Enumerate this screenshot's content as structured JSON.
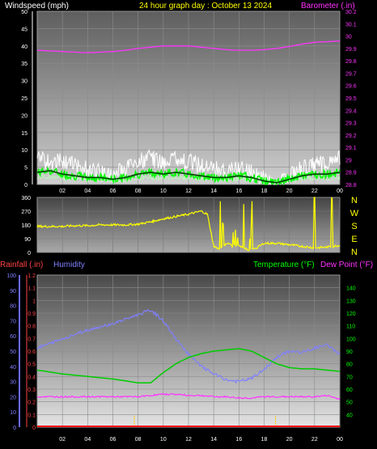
{
  "header": {
    "wind_label": "Windspeed (mph)",
    "title": "24 hour graph day : October 13 2024",
    "baro_label": "Barometer (.in)"
  },
  "labels": {
    "rain": "Rainfall (.in)",
    "humidity": "Humidity",
    "temperature": "Temperature (°F)",
    "dewpoint": "Dew Point (°F)"
  },
  "colors": {
    "background": "#000000",
    "header_text": "#ffffff",
    "title": "#ffff00",
    "barometer": "#ff33ff",
    "wind_gust": "#ffffff",
    "wind_avg": "#00ff00",
    "wind_direction": "#ffff00",
    "rain": "#ff0000",
    "humidity": "#8080ff",
    "temperature": "#00cc00",
    "dewpoint": "#ff33ff",
    "rain_axis": "#ff4444",
    "humidity_axis": "#6b6bff",
    "temp_axis": "#00ff00"
  },
  "chart_data": [
    {
      "id": "wind-baro",
      "type": "line",
      "x_ticks": [
        "02",
        "04",
        "06",
        "08",
        "10",
        "12",
        "14",
        "16",
        "18",
        "20",
        "22",
        "00"
      ],
      "x_range_hours": [
        0,
        24
      ],
      "y_left": {
        "label": "Windspeed (mph)",
        "range": [
          0,
          50
        ],
        "ticks": [
          0,
          5,
          10,
          15,
          20,
          25,
          30,
          35,
          40,
          45,
          50
        ]
      },
      "y_right": {
        "label": "Barometer (.in)",
        "range": [
          28.8,
          30.2
        ],
        "ticks": [
          "28.8",
          "28.9",
          "29",
          "29.1",
          "29.2",
          "29.3",
          "29.4",
          "29.5",
          "29.6",
          "29.7",
          "29.8",
          "29.9",
          "30",
          "30.1",
          "30.2"
        ]
      },
      "grid": true,
      "series": [
        {
          "name": "Barometer (.in)",
          "axis": "right",
          "x": [
            0,
            1,
            2,
            3,
            4,
            5,
            6,
            7,
            8,
            9,
            10,
            11,
            12,
            13,
            14,
            15,
            16,
            17,
            18,
            19,
            20,
            21,
            22,
            23,
            24
          ],
          "y": [
            29.885,
            29.88,
            29.875,
            29.87,
            29.865,
            29.87,
            29.875,
            29.885,
            29.9,
            29.91,
            29.92,
            29.92,
            29.92,
            29.91,
            29.9,
            29.89,
            29.885,
            29.885,
            29.89,
            29.9,
            29.915,
            29.935,
            29.95,
            29.955,
            29.96
          ]
        },
        {
          "name": "Windspeed gust",
          "axis": "left",
          "x": [
            0,
            1,
            2,
            3,
            4,
            5,
            6,
            7,
            8,
            9,
            10,
            11,
            12,
            13,
            14,
            15,
            16,
            17,
            18,
            19,
            20,
            21,
            22,
            23,
            24
          ],
          "y": [
            10,
            9,
            9,
            8,
            7,
            6,
            5,
            7,
            9,
            10,
            9,
            10,
            9,
            8,
            7,
            6,
            7,
            6,
            4,
            2,
            5,
            7,
            8,
            9,
            10
          ]
        },
        {
          "name": "Windspeed average",
          "axis": "left",
          "x": [
            0,
            1,
            2,
            3,
            4,
            5,
            6,
            7,
            8,
            9,
            10,
            11,
            12,
            13,
            14,
            15,
            16,
            17,
            18,
            19,
            20,
            21,
            22,
            23,
            24
          ],
          "y": [
            3.5,
            4,
            3,
            2.5,
            2,
            2,
            1.5,
            2,
            3,
            3.5,
            3,
            3.5,
            3,
            2.5,
            2,
            2,
            2.5,
            2,
            1,
            0.5,
            1.5,
            2.5,
            3,
            3,
            3.5
          ]
        }
      ]
    },
    {
      "id": "wind-direction",
      "type": "line",
      "x_range_hours": [
        0,
        24
      ],
      "y_left": {
        "range": [
          0,
          360
        ],
        "ticks": [
          0,
          90,
          180,
          270,
          360
        ]
      },
      "y_right": {
        "ticks": [
          "N",
          "W",
          "S",
          "E",
          "N"
        ]
      },
      "series": [
        {
          "name": "Wind direction",
          "x": [
            0,
            1,
            2,
            3,
            4,
            5,
            6,
            7,
            8,
            9,
            10,
            11,
            12,
            13,
            13.5,
            14,
            14.5,
            15,
            16,
            17,
            18,
            19,
            20,
            21,
            22,
            23,
            24
          ],
          "y": [
            170,
            170,
            170,
            175,
            175,
            180,
            180,
            180,
            185,
            200,
            220,
            235,
            250,
            270,
            250,
            40,
            20,
            60,
            40,
            10,
            60,
            60,
            50,
            40,
            30,
            35,
            45
          ]
        }
      ]
    },
    {
      "id": "temp-hum-rain",
      "type": "line",
      "x_ticks": [
        "02",
        "04",
        "06",
        "08",
        "10",
        "12",
        "14",
        "16",
        "18",
        "20",
        "22",
        "00"
      ],
      "x_range_hours": [
        0,
        24
      ],
      "y_left_rain": {
        "label": "Rainfall (.in)",
        "range": [
          0,
          1.2
        ],
        "ticks": [
          "0",
          "0.1",
          "0.2",
          "0.3",
          "0.4",
          "0.5",
          "0.6",
          "0.7",
          "0.8",
          "0.9",
          "1",
          "1.1",
          "1.2"
        ]
      },
      "y_left_humidity": {
        "label": "Humidity",
        "range": [
          0,
          100
        ],
        "ticks": [
          0,
          10,
          20,
          30,
          40,
          50,
          60,
          70,
          80,
          90,
          100
        ]
      },
      "y_right": {
        "label": "Temperature (°F)",
        "range": [
          30,
          150
        ],
        "ticks": [
          40,
          50,
          60,
          70,
          80,
          90,
          100,
          110,
          120,
          130,
          140
        ]
      },
      "grid": true,
      "series": [
        {
          "name": "Humidity",
          "axis": "humidity",
          "x": [
            0,
            2,
            4,
            6,
            8,
            9,
            10,
            11,
            12,
            13,
            14,
            15,
            16,
            17,
            18,
            19,
            20,
            21,
            22,
            23,
            24
          ],
          "y": [
            52,
            58,
            64,
            68,
            74,
            77,
            70,
            58,
            48,
            40,
            35,
            31,
            30,
            32,
            38,
            46,
            50,
            49,
            52,
            54,
            48
          ]
        },
        {
          "name": "Temperature (°F)",
          "axis": "right",
          "x": [
            0,
            2,
            4,
            6,
            8,
            9,
            10,
            11,
            12,
            13,
            14,
            15,
            16,
            17,
            18,
            19,
            20,
            21,
            22,
            23,
            24
          ],
          "y": [
            75,
            72,
            70,
            68,
            65,
            65,
            73,
            80,
            85,
            88,
            90,
            91,
            92,
            90,
            85,
            80,
            77,
            76,
            76,
            75,
            74
          ]
        },
        {
          "name": "Dew Point (°F)",
          "axis": "right",
          "x": [
            0,
            2,
            4,
            6,
            8,
            9,
            10,
            11,
            12,
            13,
            14,
            15,
            16,
            17,
            18,
            19,
            20,
            21,
            22,
            23,
            24
          ],
          "y": [
            54,
            54,
            54,
            54,
            54,
            55,
            56,
            56,
            55,
            55,
            54,
            54,
            53,
            53,
            54,
            54,
            54,
            54,
            54,
            55,
            52
          ]
        },
        {
          "name": "Rainfall (.in)",
          "axis": "rain",
          "x": [
            0,
            24
          ],
          "y": [
            0,
            0
          ]
        }
      ],
      "markers_hours": [
        7.7,
        18.9
      ]
    }
  ]
}
